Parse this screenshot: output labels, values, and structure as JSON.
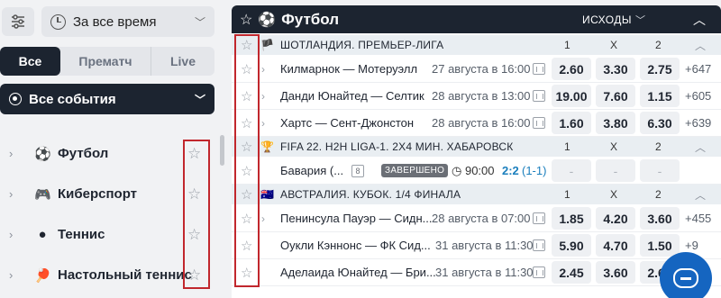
{
  "sidebar": {
    "period": "За все время",
    "tabs": [
      "Все",
      "Прематч",
      "Live"
    ],
    "events_select": "Все события",
    "sports": [
      {
        "label": "Футбол",
        "icon": "soccer-ball-icon"
      },
      {
        "label": "Киберспорт",
        "icon": "gamepad-icon"
      },
      {
        "label": "Теннис",
        "icon": "tennis-ball-icon"
      },
      {
        "label": "Настольный теннис",
        "icon": "table-tennis-icon"
      }
    ]
  },
  "main": {
    "title": "Футбол",
    "outcomes_label": "ИСХОДЫ",
    "col_headers": [
      "1",
      "X",
      "2"
    ],
    "leagues": [
      {
        "name": "ШОТЛАНДИЯ. ПРЕМЬЕР-ЛИГА",
        "flag": "scotland-flag-icon",
        "events": [
          {
            "teams": "Килмарнок — Мотеруэлл",
            "when": "27 августа в 16:00",
            "o1": "2.60",
            "ox": "3.30",
            "o2": "2.75",
            "more": "+647"
          },
          {
            "teams": "Данди Юнайтед — Селтик",
            "when": "28 августа в 13:00",
            "o1": "19.00",
            "ox": "7.60",
            "o2": "1.15",
            "more": "+605"
          },
          {
            "teams": "Хартс — Сент-Джонстон",
            "when": "28 августа в 16:00",
            "o1": "1.60",
            "ox": "3.80",
            "o2": "6.30",
            "more": "+639"
          }
        ]
      },
      {
        "name": "FIFA 22. H2H LIGA-1. 2Х4 МИН. ХАБАРОВСК",
        "flag": "trophy-icon",
        "events": [
          {
            "teams": "Бавария (...",
            "mini": "8",
            "status": "ЗАВЕРШЕНО",
            "timer": "90:00",
            "score": "2:2",
            "score_sub": "(1-1)",
            "o1": "-",
            "ox": "-",
            "o2": "-"
          }
        ]
      },
      {
        "name": "АВСТРАЛИЯ. КУБОК. 1/4 ФИНАЛА",
        "flag": "australia-flag-icon",
        "events": [
          {
            "teams": "Пенинсула Пауэр — Сидн...",
            "when": "28 августа в 07:00",
            "o1": "1.85",
            "ox": "4.20",
            "o2": "3.60",
            "more": "+455"
          },
          {
            "teams": "Оукли Кэннонс — ФК Сид...",
            "when": "31 августа в 11:30",
            "o1": "5.90",
            "ox": "4.70",
            "o2": "1.50",
            "more": "+9"
          },
          {
            "teams": "Аделаида Юнайтед — Бри...",
            "when": "31 августа в 11:30",
            "o1": "2.45",
            "ox": "3.60",
            "o2": "2.60",
            "more": ""
          }
        ]
      }
    ]
  },
  "colors": {
    "dark": "#1c2430",
    "accent_red": "#c1272d",
    "chat_blue": "#1565c0",
    "live_blue": "#1b7fbd"
  }
}
